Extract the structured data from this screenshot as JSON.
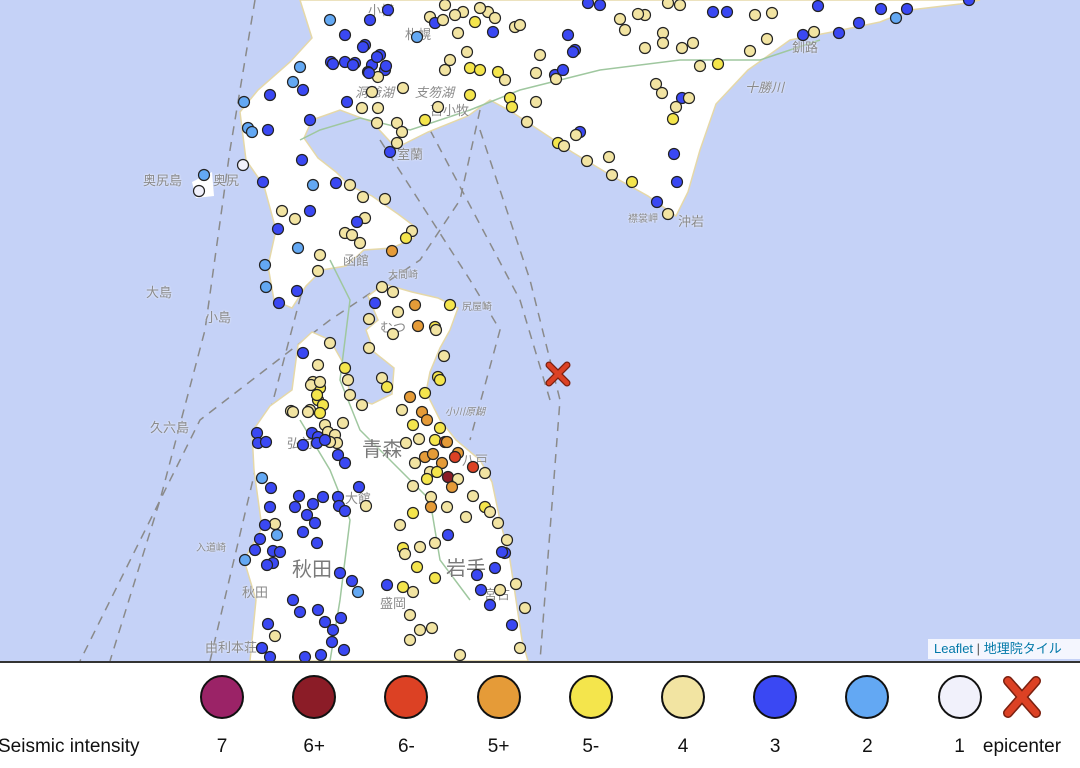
{
  "map": {
    "labels": {
      "okushiri_island": "奥尻島",
      "okushiri": "奥尻",
      "oshima": "大島",
      "kojima": "小島",
      "kyuroku": "久六島",
      "hakodate": "函館",
      "oma": "大間崎",
      "shiriya": "尻屋崎",
      "mutsu": "むつ",
      "muroran": "室蘭",
      "ogawara": "小川原湖",
      "aomori": "青森",
      "hachinohe": "八戸",
      "hirosaki": "弘前",
      "akita_pref": "秋田",
      "iwate_pref": "岩手",
      "miyako": "宮古",
      "yurihonjo": "由利本荘",
      "akita_city": "秋田",
      "odate": "大館",
      "morioka": "盛岡",
      "nyudo": "入道崎",
      "tokachi": "十勝川",
      "kushiro": "釧路",
      "erimo": "襟裳岬",
      "okiiwa": "沖岩",
      "toya": "洞爺湖",
      "shikotsu": "支笏湖",
      "tomakomai": "苫小牧",
      "sapporo": "札幌",
      "otaru": "小樽"
    },
    "attribution": {
      "leaflet": "Leaflet",
      "separator": "|",
      "tiles": "地理院タイル"
    }
  },
  "legend": {
    "title": "Seismic intensity",
    "items": [
      {
        "label": "7",
        "color": "#9b2367"
      },
      {
        "label": "6+",
        "color": "#8b1c27"
      },
      {
        "label": "6-",
        "color": "#dc4124"
      },
      {
        "label": "5+",
        "color": "#e59b38"
      },
      {
        "label": "5-",
        "color": "#f4e54c"
      },
      {
        "label": "4",
        "color": "#f2e4a2"
      },
      {
        "label": "3",
        "color": "#3a48f3"
      },
      {
        "label": "2",
        "color": "#63a8f3"
      },
      {
        "label": "1",
        "color": "#f1f1fb"
      }
    ],
    "epicenter_label": "epicenter",
    "epicenter_color": "#dc4124"
  }
}
